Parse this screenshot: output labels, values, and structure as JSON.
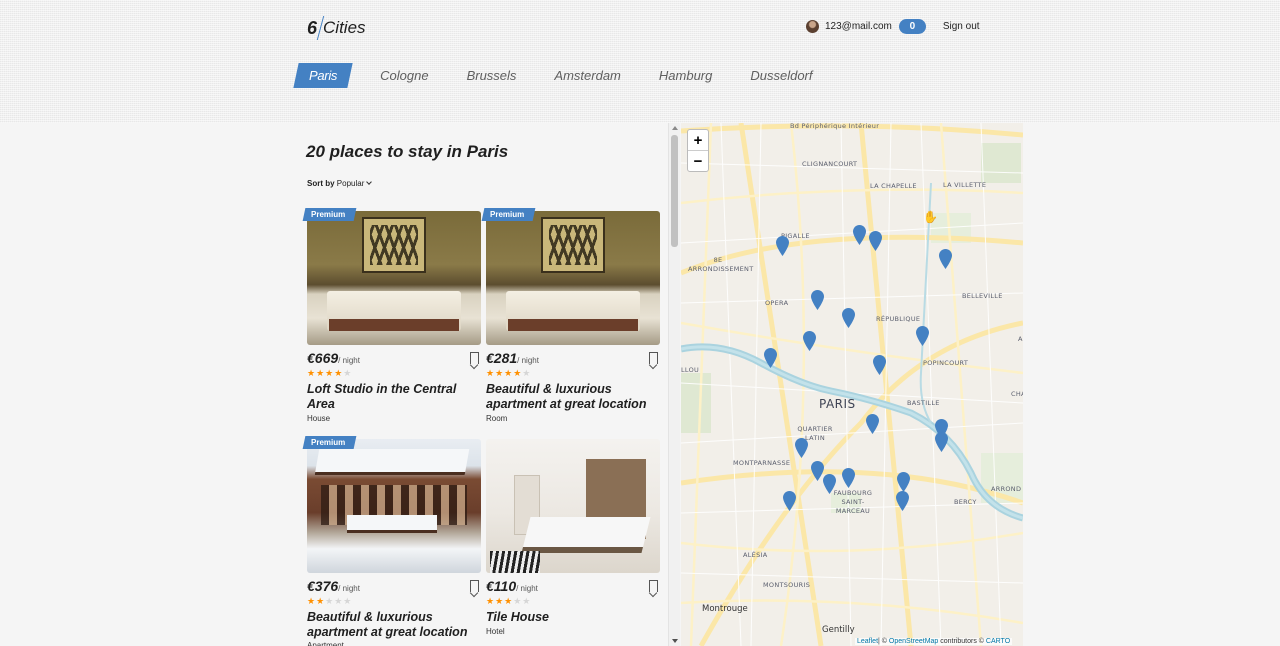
{
  "header": {
    "logo_number": "6",
    "logo_text": "Cities",
    "user_email": "123@mail.com",
    "favorites_count": "0",
    "signout_label": "Sign out"
  },
  "tabs": [
    {
      "label": "Paris",
      "active": true
    },
    {
      "label": "Cologne",
      "active": false
    },
    {
      "label": "Brussels",
      "active": false
    },
    {
      "label": "Amsterdam",
      "active": false
    },
    {
      "label": "Hamburg",
      "active": false
    },
    {
      "label": "Dusseldorf",
      "active": false
    }
  ],
  "places": {
    "title": "20 places to stay in Paris",
    "sort_label": "Sort by",
    "sort_value": "Popular"
  },
  "offers": [
    {
      "premium": "Premium",
      "price": "€669",
      "per": "/ night",
      "rating": 4,
      "name": "Loft Studio in the Central Area",
      "type": "House"
    },
    {
      "premium": "Premium",
      "price": "€281",
      "per": "/ night",
      "rating": 4,
      "name": "Beautiful & luxurious apartment at great location",
      "type": "Room"
    },
    {
      "premium": "Premium",
      "price": "€376",
      "per": "/ night",
      "rating": 2,
      "name": "Beautiful & luxurious apartment at great location",
      "type": "Apartment"
    },
    {
      "premium": "",
      "price": "€110",
      "per": "/ night",
      "rating": 3,
      "name": "Tile House",
      "type": "Hotel"
    }
  ],
  "map": {
    "zoom_in": "+",
    "zoom_out": "−",
    "city_label": "PARIS",
    "labels": [
      "CLIGNANCOURT",
      "LA CHAPELLE",
      "LA VILLETTE",
      "PIGALLE",
      "8E ARRONDISSEMENT",
      "BELLEVILLE",
      "OPERA",
      "RÉPUBLIQUE",
      "POPINCOURT",
      "BASTILLE",
      "QUARTIER LATIN",
      "MONTPARNASSE",
      "FAUBOURG SAINT-MARCEAU",
      "BERCY",
      "ALÉSIA",
      "MONTSOURIS",
      "Montrouge",
      "Gentilly"
    ],
    "attribution_leaflet": "Leaflet",
    "attribution_mid": "| © ",
    "attribution_osm": "OpenStreetMap",
    "attribution_contrib": " contributors © ",
    "attribution_carto": "CARTO",
    "marker_color": "#4481c3"
  },
  "colors": {
    "accent": "#4481c3",
    "star": "#ff9000"
  }
}
